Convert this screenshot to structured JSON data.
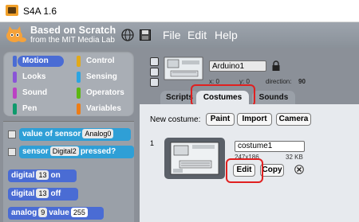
{
  "window": {
    "title": "S4A 1.6"
  },
  "menubar": {
    "logo_title": "Based on Scratch",
    "logo_subtitle": "from the MIT Media Lab",
    "menus": [
      "File",
      "Edit",
      "Help"
    ]
  },
  "palette": {
    "categories": [
      {
        "label": "Motion",
        "color": "#4a6cd4",
        "active": true
      },
      {
        "label": "Control",
        "color": "#e1a91a",
        "active": false
      },
      {
        "label": "Looks",
        "color": "#8a55d7",
        "active": false
      },
      {
        "label": "Sensing",
        "color": "#2ca5e2",
        "active": false
      },
      {
        "label": "Sound",
        "color": "#bb42c3",
        "active": false
      },
      {
        "label": "Operators",
        "color": "#5cb712",
        "active": false
      },
      {
        "label": "Pen",
        "color": "#0e9a6c",
        "active": false
      },
      {
        "label": "Variables",
        "color": "#ee7d16",
        "active": false
      }
    ],
    "blocks": {
      "b1_text": "value of sensor",
      "b1_value": "Analog0",
      "b2_text": "sensor",
      "b2_value": "Digital2",
      "b2_suffix": "pressed?",
      "b3_text": "digital",
      "b3_pin": "13",
      "b3_state": "on",
      "b4_text": "digital",
      "b4_pin": "13",
      "b4_state": "off",
      "b5_text": "analog",
      "b5_pin": "9",
      "b5_label": "value",
      "b5_value": "255"
    }
  },
  "sprite": {
    "name": "Arduino1",
    "x_label": "x: 0",
    "y_label": "y: 0",
    "direction_label": "direction:",
    "direction_value": "90"
  },
  "tabs": [
    {
      "label": "Scripts",
      "active": false
    },
    {
      "label": "Costumes",
      "active": true
    },
    {
      "label": "Sounds",
      "active": false
    }
  ],
  "costumes": {
    "new_label": "New costume:",
    "new_buttons": [
      "Paint",
      "Import",
      "Camera"
    ],
    "items": [
      {
        "index": "1",
        "name": "costume1",
        "dimensions": "247x186",
        "size": "32 KB",
        "edit_label": "Edit",
        "copy_label": "Copy"
      }
    ]
  },
  "colors": {
    "highlight": "#e02020",
    "toolbar": "#8b9098"
  }
}
